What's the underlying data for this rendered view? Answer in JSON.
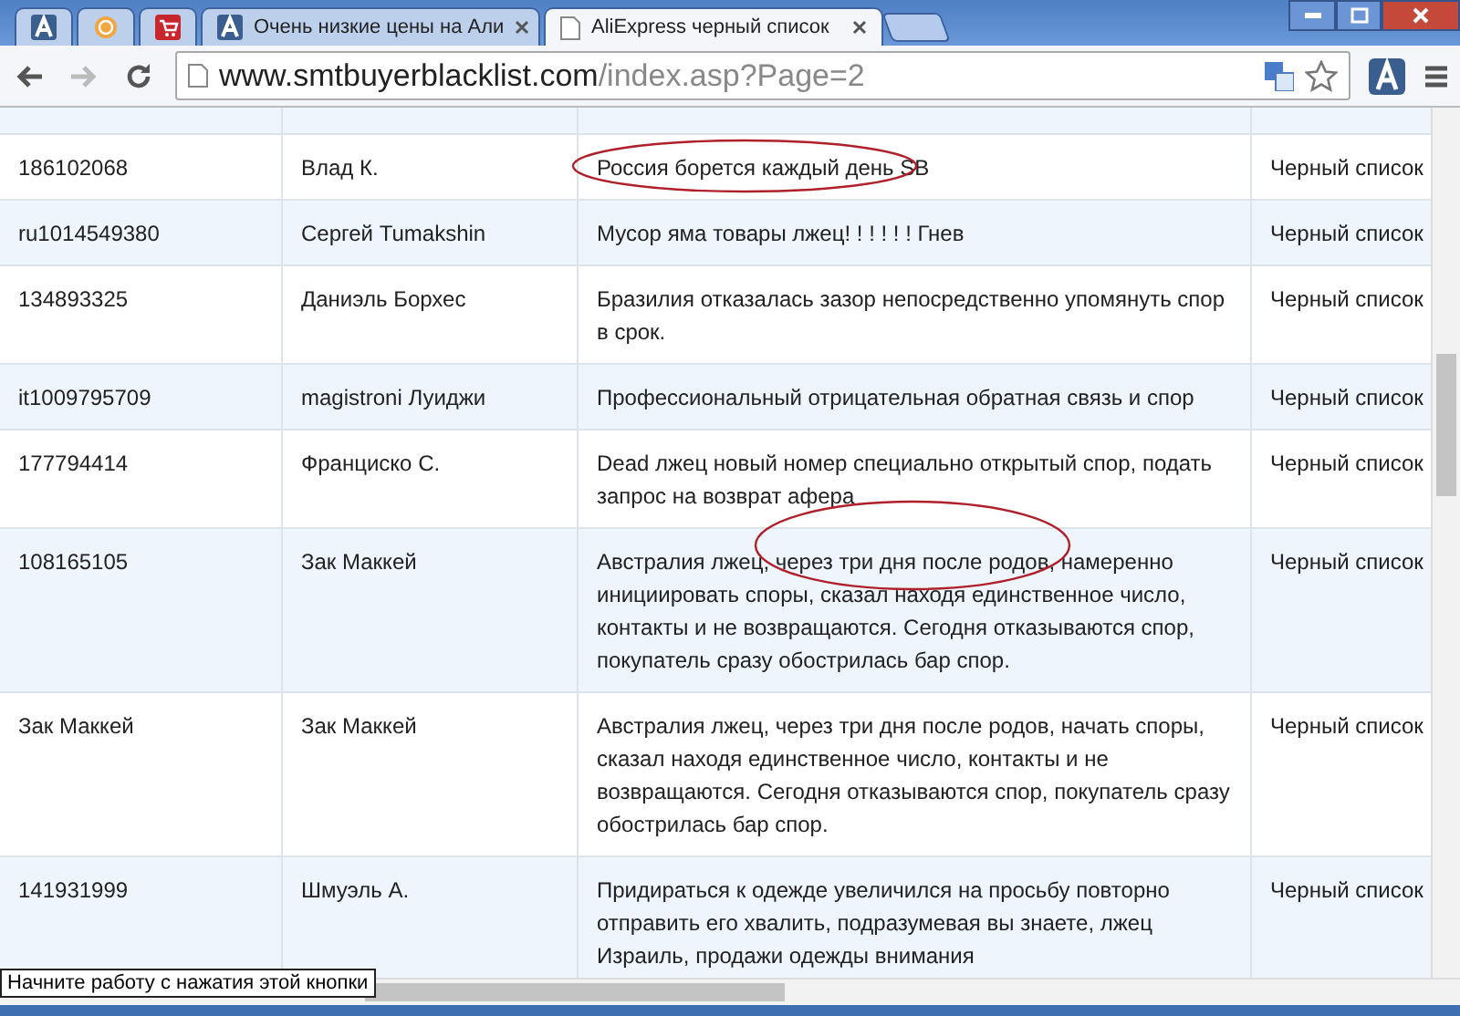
{
  "tabs": [
    {
      "kind": "pinned",
      "selected": false
    },
    {
      "kind": "pinned",
      "selected": false
    },
    {
      "kind": "pinned",
      "selected": false
    },
    {
      "kind": "page",
      "title": "Очень низкие цены на Али",
      "selected": false
    },
    {
      "kind": "page",
      "title": "AliExpress черный список",
      "selected": true
    }
  ],
  "address": {
    "host": "www.smtbuyerblacklist.com",
    "path": "/index.asp?Page=2"
  },
  "rows": [
    {
      "id": "186102068",
      "name": "Влад К.",
      "comment": "Россия борется каждый день SB",
      "status": "Черный список"
    },
    {
      "id": "ru1014549380",
      "name": "Сергей Tumakshin",
      "comment": "Мусор яма товары лжец! ! ! ! ! ! Гнев",
      "status": "Черный список"
    },
    {
      "id": "134893325",
      "name": "Даниэль Борхес",
      "comment": "Бразилия отказалась зазор непосредственно упомянуть спор в срок.",
      "status": "Черный список"
    },
    {
      "id": "it1009795709",
      "name": "magistroni Луиджи",
      "comment": "Профессиональный отрицательная обратная связь и спор",
      "status": "Черный список"
    },
    {
      "id": "177794414",
      "name": "Франциско С.",
      "comment": "Dead лжец новый номер специально открытый спор, подать запрос на возврат афера",
      "status": "Черный список"
    },
    {
      "id": "108165105",
      "name": "Зак Маккей",
      "comment": "Австралия лжец, через три дня после родов, намеренно инициировать споры, сказал находя единственное число, контакты и не возвращаются. Сегодня отказываются спор, покупатель сразу обострилась бар спор.",
      "status": "Черный список"
    },
    {
      "id": "Зак Маккей",
      "name": "Зак Маккей",
      "comment": "Австралия лжец, через три дня после родов, начать споры, сказал находя единственное число, контакты и не возвращаются. Сегодня отказываются спор, покупатель сразу обострилась бар спор.",
      "status": "Черный список"
    },
    {
      "id": "141931999",
      "name": "Шмуэль А.",
      "comment": "Придираться к одежде увеличился на просьбу повторно отправить его хвалить, подразумевая вы знаете, лжец Израиль, продажи одежды внимания",
      "status": "Черный список"
    }
  ],
  "tooltip": "Начните работу с нажатия этой кнопки"
}
